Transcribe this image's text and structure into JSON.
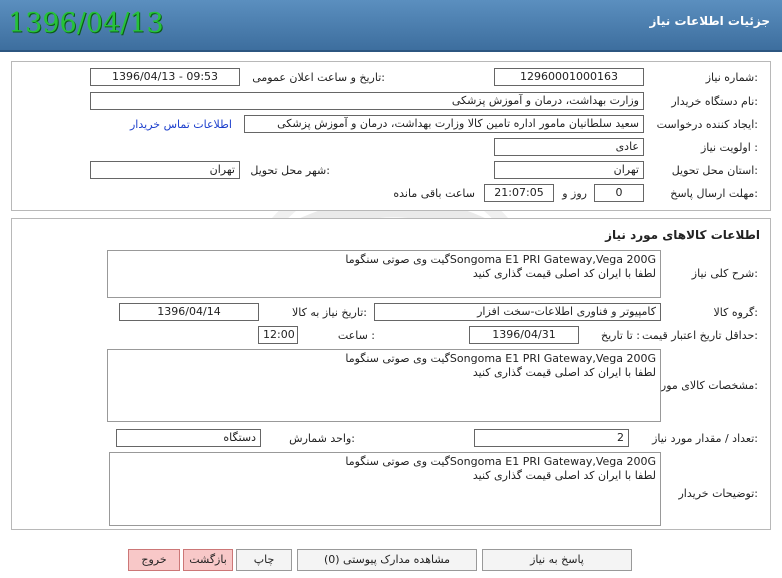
{
  "header": {
    "title": "جزئیات اطلاعات نیاز",
    "date": "1396/04/13"
  },
  "general": {
    "need_number_label": "شماره نیاز:",
    "need_number": "12960001000163",
    "announce_label": "تاریخ و ساعت اعلان عمومی:",
    "announce": "1396/04/13 - 09:53",
    "buyer_label": "نام دستگاه خریدار:",
    "buyer": "وزارت بهداشت، درمان و آموزش پزشکی",
    "creator_label": "ایجاد کننده درخواست:",
    "creator": "سعید سلطانیان مامور اداره تامین کالا وزارت بهداشت، درمان و آموزش پزشکی",
    "contact_link": "اطلاعات تماس خریدار",
    "priority_label": "اولویت نیاز :",
    "priority": "عادی",
    "province_label": "استان محل تحویل:",
    "province": "تهران",
    "city_label": "شهر محل تحویل:",
    "city": "تهران",
    "deadline_label": "مهلت ارسال پاسخ:",
    "days": "0",
    "days_unit": "روز و",
    "time_left": "21:07:05",
    "time_left_label": "ساعت باقی مانده"
  },
  "goods": {
    "section_title": "اطلاعات کالاهای مورد نیاز",
    "desc_label": "شرح کلی نیاز:",
    "desc_line1": "Songoma E1 PRI Gateway,Vega 200Gگیت وی صوتی سنگوما",
    "desc_line2": "لطفا با ایران کد اصلی قیمت گذاری کنید",
    "group_label": "گروه کالا:",
    "group": "کامپیوتر و فناوری اطلاعات-سخت افزار",
    "need_date_label": "تاریخ نیاز به کالا:",
    "need_date": "1396/04/14",
    "validity_label": "حداقل تاریخ اعتبار قیمت:",
    "to_date_label": "تا تاریخ :",
    "to_date": "1396/04/31",
    "hour_label": "ساعت :",
    "hour": "12:00",
    "spec_label": "مشخصات کالای مورد نیاز:",
    "qty_label": "تعداد / مقدار مورد نیاز:",
    "qty": "2",
    "unit_label": "واحد شمارش:",
    "unit": "دستگاه",
    "buyer_notes_label": "توضیحات خریدار:"
  },
  "buttons": {
    "reply": "پاسخ به نیاز",
    "attachments": "مشاهده مدارک پیوستی (0)",
    "print": "چاپ",
    "back": "بازگشت",
    "exit": "خروج"
  }
}
